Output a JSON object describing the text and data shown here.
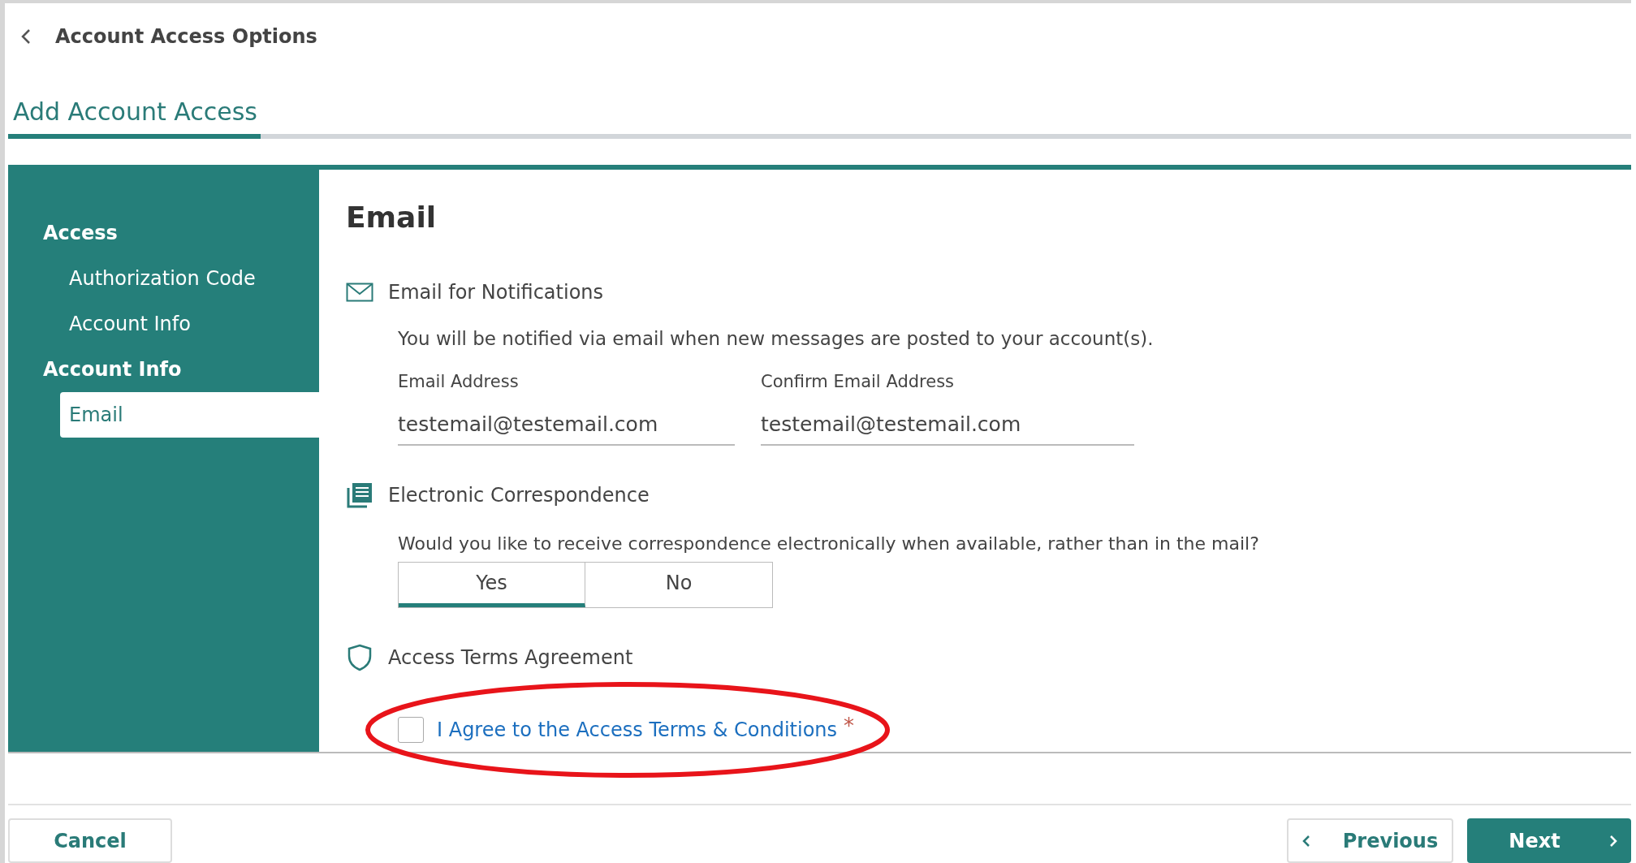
{
  "header": {
    "title": "Account Access Options"
  },
  "tabs": [
    {
      "label": "Add Account Access",
      "selected": true
    }
  ],
  "sidebar": {
    "items": [
      {
        "label": "Access",
        "selected": false,
        "children": [
          {
            "label": "Authorization Code",
            "selected": false
          },
          {
            "label": "Account Info",
            "selected": false
          }
        ]
      },
      {
        "label": "Account Info",
        "selected": false,
        "children": [
          {
            "label": "Email",
            "selected": true
          }
        ]
      }
    ]
  },
  "content": {
    "title": "Email",
    "notifications": {
      "heading": "Email for Notifications",
      "description": "You will be notified via email when new messages are posted to your account(s).",
      "fields": [
        {
          "label": "Email Address",
          "value": "testemail@testemail.com"
        },
        {
          "label": "Confirm Email Address",
          "value": "testemail@testemail.com"
        }
      ]
    },
    "correspondence": {
      "heading": "Electronic Correspondence",
      "question": "Would you like to receive correspondence electronically when available, rather than in the mail?",
      "options": [
        {
          "label": "Yes",
          "selected": true
        },
        {
          "label": "No",
          "selected": false
        }
      ]
    },
    "terms": {
      "heading": "Access Terms Agreement",
      "checkbox": {
        "label": "I Agree to the Access Terms & Conditions",
        "checked": false,
        "required_mark": "*"
      }
    }
  },
  "footer": {
    "cancel": "Cancel",
    "previous": "Previous",
    "next": "Next"
  }
}
